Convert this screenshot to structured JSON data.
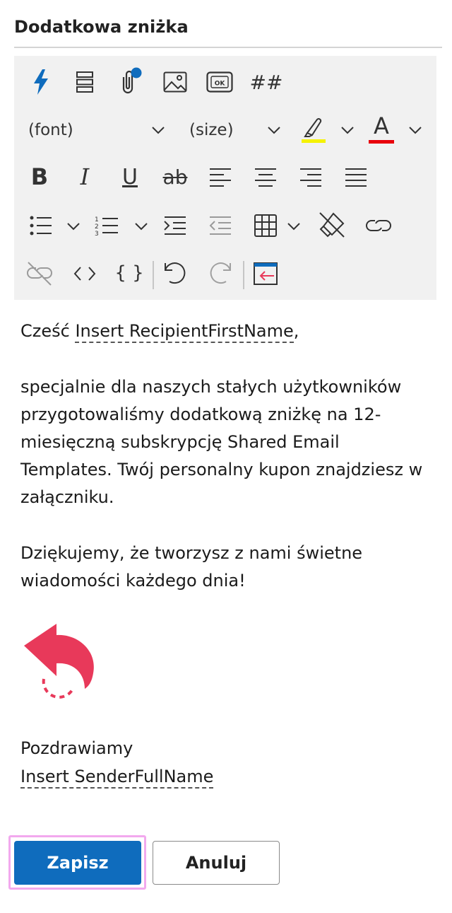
{
  "dialog": {
    "title": "Dodatkowa zniżka"
  },
  "toolbar": {
    "icons": [
      "lightning-icon",
      "rows-icon",
      "attachment-icon",
      "image-icon",
      "ok-badge-icon",
      "hash-icon",
      "bold-icon",
      "italic-icon",
      "underline-icon",
      "strikethrough-icon",
      "align-left-icon",
      "align-center-icon",
      "align-right-icon",
      "justify-icon",
      "bulleted-list-icon",
      "numbered-list-icon",
      "increase-indent-icon",
      "decrease-indent-icon",
      "table-icon",
      "clear-formatting-icon",
      "link-icon",
      "unlink-icon",
      "code-view-icon",
      "braces-icon",
      "undo-icon",
      "redo-icon",
      "insert-template-icon"
    ],
    "font_label": "(font)",
    "size_label": "(size)",
    "bold_glyph": "B",
    "italic_glyph": "I",
    "underline_glyph": "U",
    "strike_glyph": "ab",
    "font_color_glyph": "A",
    "hash_glyph": "##",
    "ok_glyph": "OK",
    "braces_glyph": "{ }",
    "highlight_color": "#f5f200",
    "font_color": "#e8000b",
    "accent_color": "#0f6cbd"
  },
  "message": {
    "greeting_prefix": "Cześć ",
    "greeting_placeholder": "Insert RecipientFirstName",
    "greeting_suffix": ",",
    "paragraph1": "specjalnie dla naszych stałych użytkowników przygotowaliśmy dodatkową zniżkę na 12-miesięczną subskrypcję Shared Email Templates. Twój personalny kupon znajdziesz w załączniku.",
    "paragraph2": "Dziękujemy, że tworzysz z nami świetne wiadomości każdego dnia!",
    "image_icon": "return-arrow-icon",
    "signoff": "Pozdrawiamy",
    "sender_placeholder": "Insert SenderFullName"
  },
  "buttons": {
    "save": "Zapisz",
    "cancel": "Anuluj"
  },
  "colors": {
    "primary": "#0f6cbd",
    "focus": "#f2a9ee",
    "arrow": "#e8395a"
  }
}
